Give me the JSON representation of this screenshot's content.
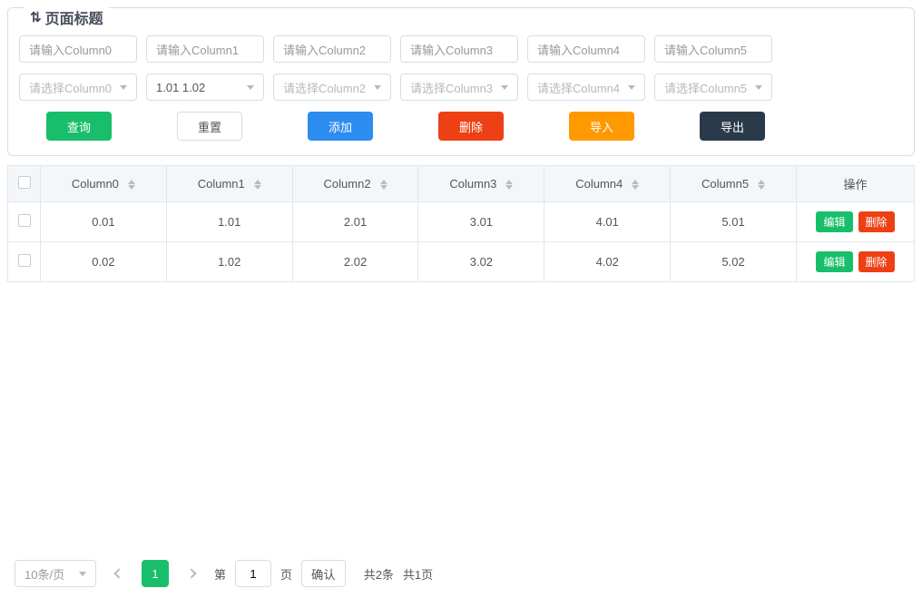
{
  "panel": {
    "title": "页面标题"
  },
  "inputs": [
    {
      "placeholder": "请输入Column0"
    },
    {
      "placeholder": "请输入Column1"
    },
    {
      "placeholder": "请输入Column2"
    },
    {
      "placeholder": "请输入Column3"
    },
    {
      "placeholder": "请输入Column4"
    },
    {
      "placeholder": "请输入Column5"
    }
  ],
  "selects": [
    {
      "placeholder": "请选择Column0",
      "value": ""
    },
    {
      "placeholder": "",
      "value": "1.01 1.02"
    },
    {
      "placeholder": "请选择Column2",
      "value": ""
    },
    {
      "placeholder": "请选择Column3",
      "value": ""
    },
    {
      "placeholder": "请选择Column4",
      "value": ""
    },
    {
      "placeholder": "请选择Column5",
      "value": ""
    }
  ],
  "buttons": {
    "query": "查询",
    "reset": "重置",
    "add": "添加",
    "delete": "删除",
    "import": "导入",
    "export": "导出"
  },
  "table": {
    "headers": [
      "Column0",
      "Column1",
      "Column2",
      "Column3",
      "Column4",
      "Column5"
    ],
    "op_header": "操作",
    "rows": [
      {
        "cells": [
          "0.01",
          "1.01",
          "2.01",
          "3.01",
          "4.01",
          "5.01"
        ]
      },
      {
        "cells": [
          "0.02",
          "1.02",
          "2.02",
          "3.02",
          "4.02",
          "5.02"
        ]
      }
    ],
    "op_edit": "编辑",
    "op_delete": "删除"
  },
  "pagination": {
    "page_size_label": "10条/页",
    "current_page": "1",
    "jump_prefix": "第",
    "jump_input": "1",
    "jump_suffix": "页",
    "confirm": "确认",
    "total_records": "共2条",
    "total_pages": "共1页"
  }
}
